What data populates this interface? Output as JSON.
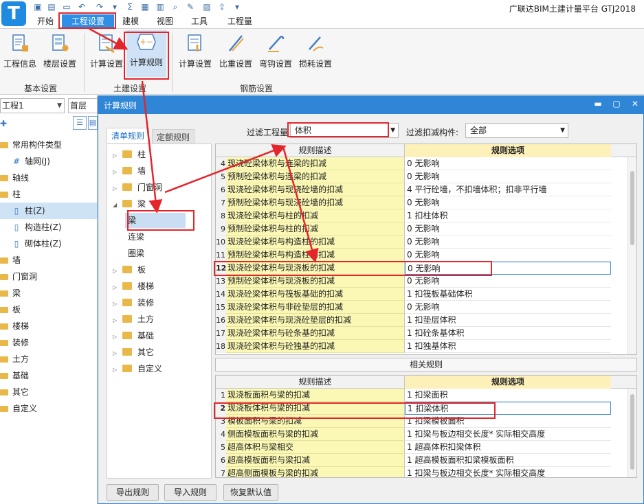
{
  "app": {
    "title": "广联达BIM土建计量平台 GTJ2018",
    "logo_letter": "T"
  },
  "menu": {
    "tabs": [
      {
        "label": "开始"
      },
      {
        "label": "工程设置"
      },
      {
        "label": "建模"
      },
      {
        "label": "视图"
      },
      {
        "label": "工具"
      },
      {
        "label": "工程量"
      }
    ]
  },
  "ribbon": {
    "groups": [
      {
        "label": "基本设置",
        "buttons": [
          {
            "label": "工程信息"
          },
          {
            "label": "楼层设置"
          }
        ]
      },
      {
        "label": "土建设置",
        "buttons": [
          {
            "label": "计算设置"
          },
          {
            "label": "计算规则"
          }
        ]
      },
      {
        "label": "钢筋设置",
        "buttons": [
          {
            "label": "计算设置"
          },
          {
            "label": "比重设置"
          },
          {
            "label": "弯钩设置"
          },
          {
            "label": "损耗设置"
          }
        ]
      }
    ]
  },
  "left_panel": {
    "project_combo": "工程1",
    "floor_combo": "首层",
    "tree": [
      {
        "label": "常用构件类型",
        "type": "folder"
      },
      {
        "label": "轴网(J)",
        "type": "sub",
        "icon": "grid-axis-icon"
      },
      {
        "label": "轴线",
        "type": "folder"
      },
      {
        "label": "柱",
        "type": "folder"
      },
      {
        "label": "柱(Z)",
        "type": "sub",
        "icon": "column-icon",
        "selected": true
      },
      {
        "label": "构造柱(Z)",
        "type": "sub",
        "icon": "column-icon"
      },
      {
        "label": "砌体柱(Z)",
        "type": "sub",
        "icon": "column-icon"
      },
      {
        "label": "墙",
        "type": "folder"
      },
      {
        "label": "门窗洞",
        "type": "folder"
      },
      {
        "label": "梁",
        "type": "folder"
      },
      {
        "label": "板",
        "type": "folder"
      },
      {
        "label": "楼梯",
        "type": "folder"
      },
      {
        "label": "装修",
        "type": "folder"
      },
      {
        "label": "土方",
        "type": "folder"
      },
      {
        "label": "基础",
        "type": "folder"
      },
      {
        "label": "其它",
        "type": "folder"
      },
      {
        "label": "自定义",
        "type": "folder"
      }
    ]
  },
  "dialog": {
    "title": "计算规则",
    "subtabs": [
      {
        "label": "清单规则"
      },
      {
        "label": "定额规则"
      }
    ],
    "filter_quantity_label": "过滤工程量",
    "filter_quantity_value": "体积",
    "filter_deduct_label": "过滤扣减构件:",
    "filter_deduct_value": "全部",
    "component_tree": [
      {
        "label": "柱",
        "kind": "folder",
        "exp": "▷"
      },
      {
        "label": "墙",
        "kind": "folder",
        "exp": "▷"
      },
      {
        "label": "门窗洞",
        "kind": "folder",
        "exp": "▷"
      },
      {
        "label": "梁",
        "kind": "folder",
        "exp": "◢"
      },
      {
        "label": "梁",
        "kind": "child",
        "selected": true
      },
      {
        "label": "连梁",
        "kind": "child"
      },
      {
        "label": "圈梁",
        "kind": "child"
      },
      {
        "label": "板",
        "kind": "folder",
        "exp": "▷"
      },
      {
        "label": "楼梯",
        "kind": "folder",
        "exp": "▷"
      },
      {
        "label": "装修",
        "kind": "folder",
        "exp": "▷"
      },
      {
        "label": "土方",
        "kind": "folder",
        "exp": "▷"
      },
      {
        "label": "基础",
        "kind": "folder",
        "exp": "▷"
      },
      {
        "label": "其它",
        "kind": "folder",
        "exp": "▷"
      },
      {
        "label": "自定义",
        "kind": "folder",
        "exp": "▷"
      }
    ],
    "rules_grid": {
      "col_desc": "规则描述",
      "col_option": "规则选项",
      "rows": [
        {
          "n": "4",
          "desc": "现浇砼梁体积与连梁的扣减",
          "opt": "0  无影响"
        },
        {
          "n": "5",
          "desc": "预制砼梁体积与连梁的扣减",
          "opt": "0  无影响"
        },
        {
          "n": "6",
          "desc": "现浇砼梁体积与现浇砼墙的扣减",
          "opt": "4  平行砼墙，不扣墙体积；扣非平行墙"
        },
        {
          "n": "7",
          "desc": "预制砼梁体积与现浇砼墙的扣减",
          "opt": "0  无影响"
        },
        {
          "n": "8",
          "desc": "现浇砼梁体积与柱的扣减",
          "opt": "1  扣柱体积"
        },
        {
          "n": "9",
          "desc": "预制砼梁体积与柱的扣减",
          "opt": "0  无影响"
        },
        {
          "n": "10",
          "desc": "现浇砼梁体积与构造柱的扣减",
          "opt": "0  无影响"
        },
        {
          "n": "11",
          "desc": "预制砼梁体积与构造柱的扣减",
          "opt": "0  无影响"
        },
        {
          "n": "12",
          "desc": "现浇砼梁体积与现浇板的扣减",
          "opt": "0  无影响",
          "active": true
        },
        {
          "n": "13",
          "desc": "预制砼梁体积与现浇板的扣减",
          "opt": "0  无影响"
        },
        {
          "n": "14",
          "desc": "现浇砼梁体积与筏板基础的扣减",
          "opt": "1  扣筏板基础体积"
        },
        {
          "n": "15",
          "desc": "现浇砼梁体积与非砼垫层的扣减",
          "opt": "0  无影响"
        },
        {
          "n": "16",
          "desc": "现浇砼梁体积与现浇砼垫层的扣减",
          "opt": "1  扣垫层体积"
        },
        {
          "n": "17",
          "desc": "现浇砼梁体积与砼条基的扣减",
          "opt": "1  扣砼条基体积"
        },
        {
          "n": "18",
          "desc": "现浇砼梁体积与砼独基的扣减",
          "opt": "1  扣独基体积"
        }
      ]
    },
    "related_title": "相关规则",
    "related_grid": {
      "col_desc": "规则描述",
      "col_option": "规则选项",
      "rows": [
        {
          "n": "1",
          "desc": "现浇板面积与梁的扣减",
          "opt": "1  扣梁面积"
        },
        {
          "n": "2",
          "desc": "现浇板体积与梁的扣减",
          "opt": "1  扣梁体积",
          "active": true
        },
        {
          "n": "3",
          "desc": "模板面积与梁的扣减",
          "opt": "1  扣梁模板面积"
        },
        {
          "n": "4",
          "desc": "侧面模板面积与梁的扣减",
          "opt": "1  扣梁与板边相交长度* 实际相交高度"
        },
        {
          "n": "5",
          "desc": "超高体积与梁相交",
          "opt": "1  超高体积扣梁体积"
        },
        {
          "n": "6",
          "desc": "超高模板面积与梁扣减",
          "opt": "1  超高模板面积扣梁模板面积"
        },
        {
          "n": "7",
          "desc": "超高侧面模板与梁的扣减",
          "opt": "1  扣梁与板边相交长度* 实际相交高度"
        }
      ]
    },
    "buttons": {
      "export": "导出规则",
      "import": "导入规则",
      "restore": "恢复默认值"
    }
  },
  "colors": {
    "accent": "#2f86d6",
    "annotation": "#e3262c",
    "desc_cell": "#faf8b4",
    "option_header": "#fdf0b8"
  }
}
